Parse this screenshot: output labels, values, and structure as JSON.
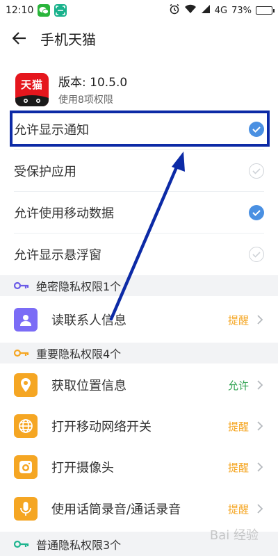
{
  "status_bar": {
    "time": "12:10",
    "network": "4G",
    "battery": "73%",
    "battery_level": 0.73,
    "notification_icons": [
      "wechat-icon",
      "scanner-icon"
    ],
    "system_icons": [
      "alarm-icon",
      "wifi-icon",
      "signal-icon",
      "battery-icon"
    ]
  },
  "header": {
    "title": "手机天猫",
    "back_icon": "arrow-left-icon"
  },
  "app": {
    "logo_text": "天猫",
    "version": "版本: 10.5.0",
    "permission_count": "使用8项权限"
  },
  "toggles": [
    {
      "label": "允许显示通知",
      "checked": true
    },
    {
      "label": "受保护应用",
      "checked": false
    },
    {
      "label": "允许使用移动数据",
      "checked": true
    },
    {
      "label": "允许显示悬浮窗",
      "checked": false
    }
  ],
  "sections": {
    "top_secret": "绝密隐私权限1个",
    "important": "重要隐私权限4个",
    "normal": "普通隐私权限3个"
  },
  "permissions": [
    {
      "label": "读联系人信息",
      "status": "提醒",
      "icon": "contact-icon",
      "icon_color": "#7b6cf6",
      "status_color": "#f5a623"
    },
    {
      "label": "获取位置信息",
      "status": "允许",
      "icon": "location-icon",
      "icon_color": "#f5a623",
      "status_color": "#2ea14f"
    },
    {
      "label": "打开移动网络开关",
      "status": "提醒",
      "icon": "globe-icon",
      "icon_color": "#f5a623",
      "status_color": "#f5a623"
    },
    {
      "label": "打开摄像头",
      "status": "提醒",
      "icon": "camera-icon",
      "icon_color": "#f5a623",
      "status_color": "#f5a623"
    },
    {
      "label": "使用话筒录音/通话录音",
      "status": "提醒",
      "icon": "microphone-icon",
      "icon_color": "#f5a623",
      "status_color": "#f5a623"
    }
  ],
  "watermark": "Bai 经验",
  "colors": {
    "accent_blue": "#4a90e2",
    "highlight_border": "#0c2aa6",
    "warning_orange": "#f5a623",
    "allow_green": "#2ea14f",
    "section_bg": "#f2f3f5"
  }
}
